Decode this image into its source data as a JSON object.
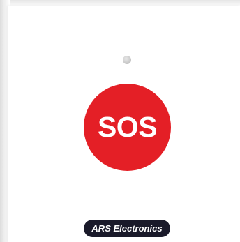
{
  "device": {
    "button_label": "SOS",
    "brand_label": "ARS Electronics",
    "button_color": "#e41f26",
    "badge_color": "#1a1a2a",
    "indicator_color": "#c9c9c9",
    "indicator_icon": "status-led-icon"
  }
}
